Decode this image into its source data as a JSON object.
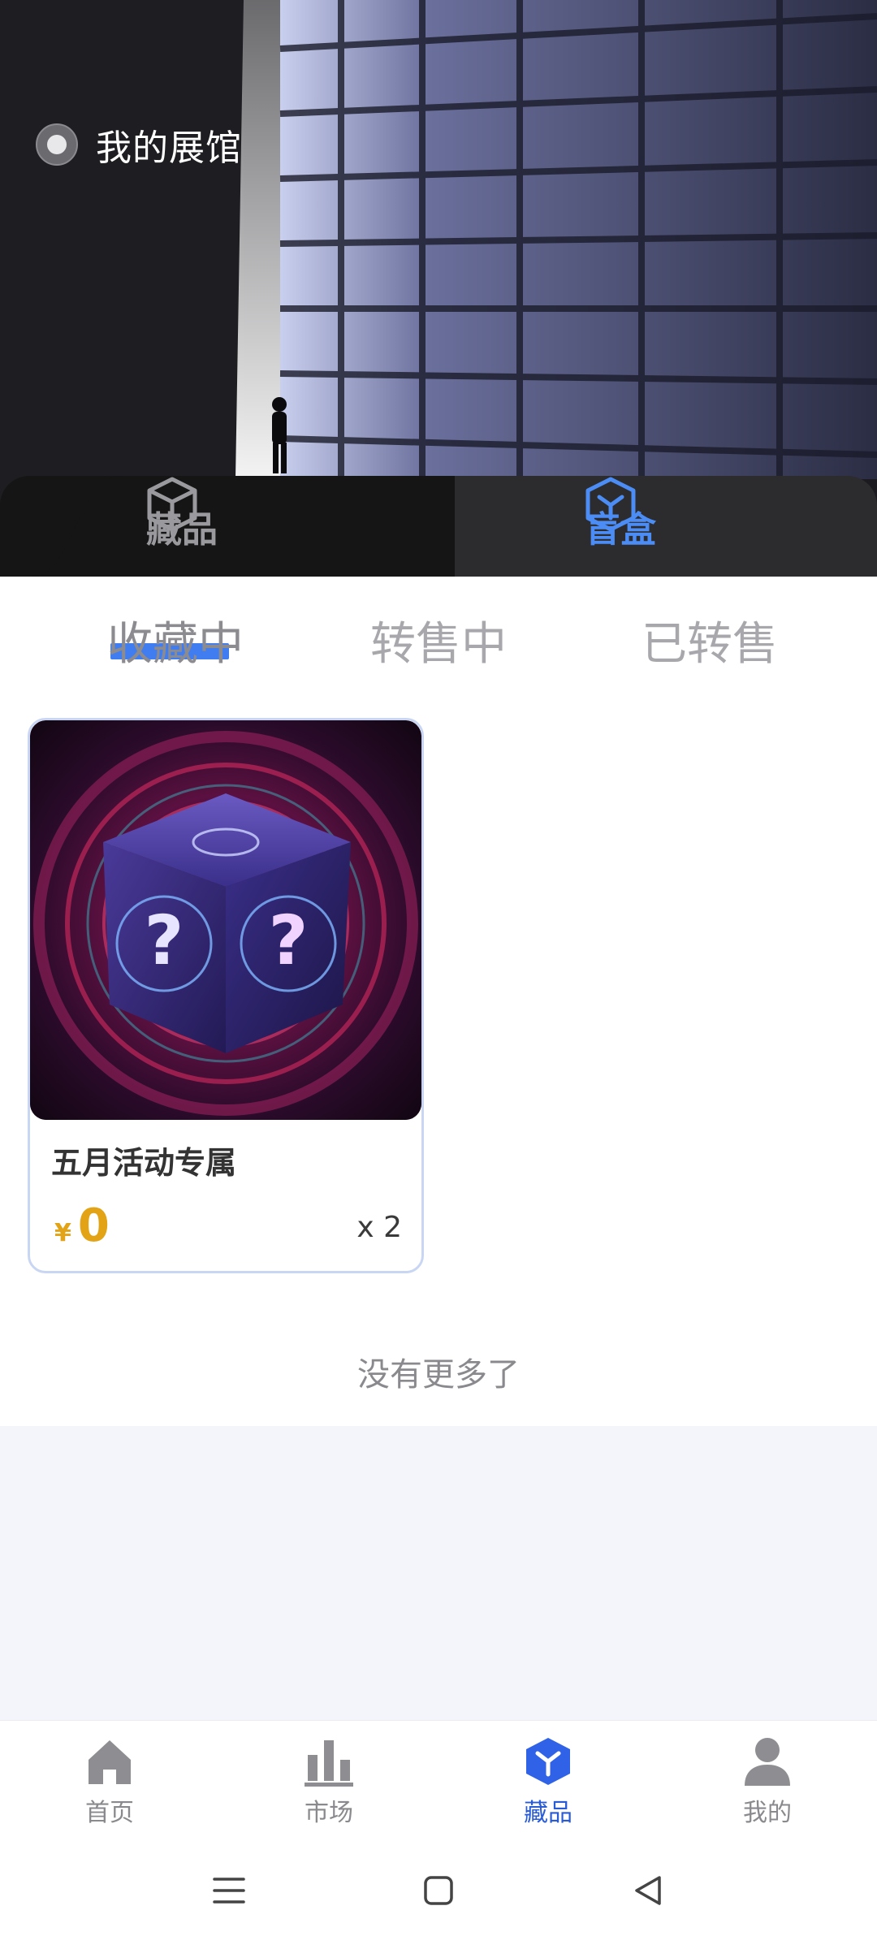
{
  "hero": {
    "title": "我的展馆"
  },
  "segments": {
    "collection": "藏品",
    "blind_box": "盲盒",
    "active": "blind_box"
  },
  "subtabs": {
    "items": [
      "收藏中",
      "转售中",
      "已转售"
    ],
    "active_index": 0
  },
  "card": {
    "name": "五月活动专属",
    "currency": "¥",
    "price": "0",
    "quantity": "x 2"
  },
  "list_end_text": "没有更多了",
  "bottom_nav": {
    "items": [
      {
        "label": "首页",
        "icon": "home-icon"
      },
      {
        "label": "市场",
        "icon": "market-chart-icon"
      },
      {
        "label": "藏品",
        "icon": "collection-cube-icon"
      },
      {
        "label": "我的",
        "icon": "profile-icon"
      }
    ],
    "active_index": 2
  },
  "colors": {
    "accent": "#4b8cf5",
    "price": "#e2a416",
    "nav_active": "#2a5bd7"
  }
}
